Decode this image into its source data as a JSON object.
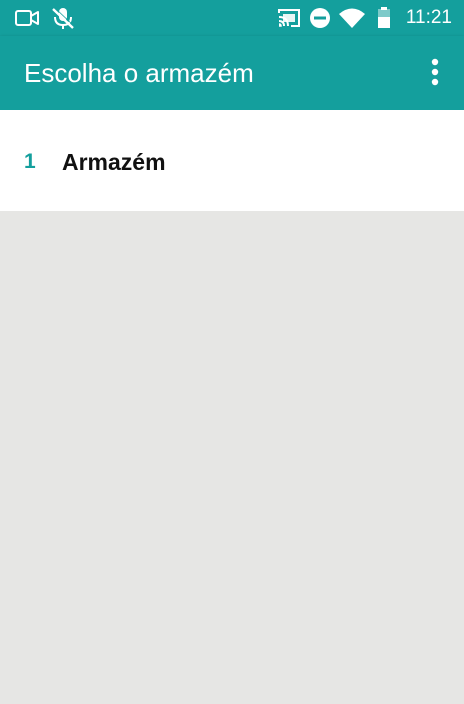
{
  "status_bar": {
    "time": "11:21",
    "icons": [
      "video-camera-icon",
      "mic-off-icon",
      "cast-icon",
      "do-not-disturb-icon",
      "wifi-icon",
      "battery-icon"
    ]
  },
  "app_bar": {
    "title": "Escolha o armazém",
    "menu_icon": "more-vert-icon"
  },
  "list": {
    "items": [
      {
        "index": "1",
        "label": "Armazém"
      }
    ]
  },
  "colors": {
    "primary": "#149f9d",
    "background": "#e6e6e4",
    "surface": "#ffffff",
    "text": "#111111"
  }
}
